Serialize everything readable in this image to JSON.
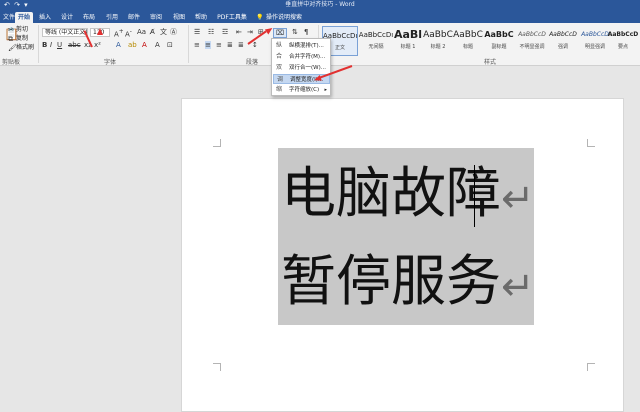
{
  "window": {
    "quick_access": "↶ ↷ ▾",
    "title": "垂直拼中对齐技巧 - Word"
  },
  "tabs": [
    "文件",
    "开始",
    "插入",
    "设计",
    "布局",
    "引用",
    "邮件",
    "审阅",
    "视图",
    "帮助",
    "PDF工具集",
    "操作说明搜索"
  ],
  "tab_icons": {
    "search": "lightbulb-icon"
  },
  "clipboard": {
    "cut": "剪切",
    "copy": "复制",
    "format_painter": "格式刷",
    "group_label": "剪贴板"
  },
  "font": {
    "font_name": "等线 (中文正文)",
    "font_size": "120",
    "group_label": "字体"
  },
  "paragraph": {
    "group_label": "段落"
  },
  "styles": {
    "items": [
      {
        "preview": "AaBbCcDı",
        "name": "正文"
      },
      {
        "preview": "AaBbCcDı",
        "name": "无间隔"
      },
      {
        "preview": "AaBl",
        "name": "标题 1"
      },
      {
        "preview": "AaBbC",
        "name": "标题 2"
      },
      {
        "preview": "AaBbC",
        "name": "标题"
      },
      {
        "preview": "AaBbC",
        "name": "副标题"
      },
      {
        "preview": "AaBbCcD",
        "name": "不明显强调"
      },
      {
        "preview": "AaBbCcD",
        "name": "强调"
      },
      {
        "preview": "AaBbCcD",
        "name": "明显强调"
      },
      {
        "preview": "AaBbCcD",
        "name": "要点"
      }
    ],
    "group_label": "样式"
  },
  "dropdown_menu": {
    "items": [
      {
        "icon": "纵",
        "label": "纵横混排(T)..."
      },
      {
        "icon": "合",
        "label": "合并字符(M)..."
      },
      {
        "icon": "双",
        "label": "双行合一(W)..."
      },
      {
        "icon": "调",
        "label": "调整宽度(I)...",
        "highlighted": true
      },
      {
        "icon": "缩",
        "label": "字符缩放(C)",
        "submenu": true
      }
    ]
  },
  "document": {
    "line1": "电脑故障",
    "line2": "暂停服务",
    "paragraph_mark": "↵"
  },
  "colors": {
    "ribbon_blue": "#2b579a",
    "selection_gray": "#c8c8c8",
    "annotation_red": "#e23131"
  }
}
